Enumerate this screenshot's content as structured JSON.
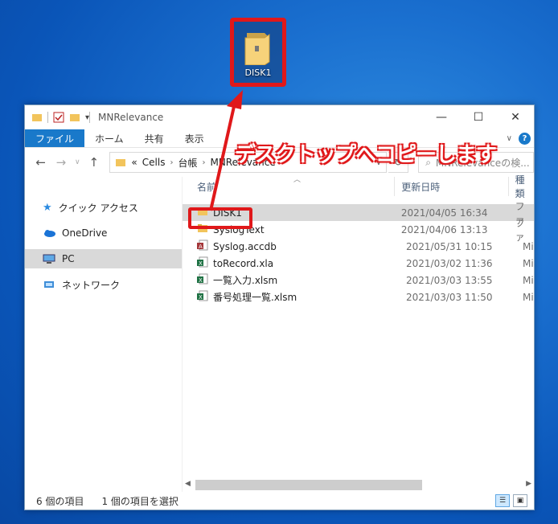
{
  "desktop": {
    "icon_label": "DISK1"
  },
  "window": {
    "title": "MNRelevance",
    "ribbon_tabs": [
      "ファイル",
      "ホーム",
      "共有",
      "表示"
    ],
    "address": {
      "prefix": "«",
      "crumbs": [
        "Cells",
        "台帳",
        "MNRelevance"
      ]
    },
    "search_placeholder": "MNRelevanceの検..."
  },
  "nav": [
    "クイック アクセス",
    "OneDrive",
    "PC",
    "ネットワーク"
  ],
  "columns": {
    "name": "名前",
    "date": "更新日時",
    "type": "種類"
  },
  "files": [
    {
      "name": "DISK1",
      "date": "2021/04/05 16:34",
      "type": "ファ",
      "icon": "folder-icon"
    },
    {
      "name": "SyslogText",
      "date": "2021/04/06 13:13",
      "type": "ファ",
      "icon": "folder-icon"
    },
    {
      "name": "Syslog.accdb",
      "date": "2021/05/31 10:15",
      "type": "Mi",
      "icon": "access-file-icon"
    },
    {
      "name": "toRecord.xla",
      "date": "2021/03/02 11:36",
      "type": "Mi",
      "icon": "excel-file-icon"
    },
    {
      "name": "一覧入力.xlsm",
      "date": "2021/03/03 13:55",
      "type": "Mi",
      "icon": "excel-file-icon"
    },
    {
      "name": "番号処理一覧.xlsm",
      "date": "2021/03/03 11:50",
      "type": "Mi",
      "icon": "excel-file-icon"
    }
  ],
  "status": {
    "count": "6 個の項目",
    "selected": "1 個の項目を選択"
  },
  "annotation": "デスクトップへコピーします",
  "colors": {
    "highlight": "#e0181a",
    "file_tab": "#1979ca"
  }
}
